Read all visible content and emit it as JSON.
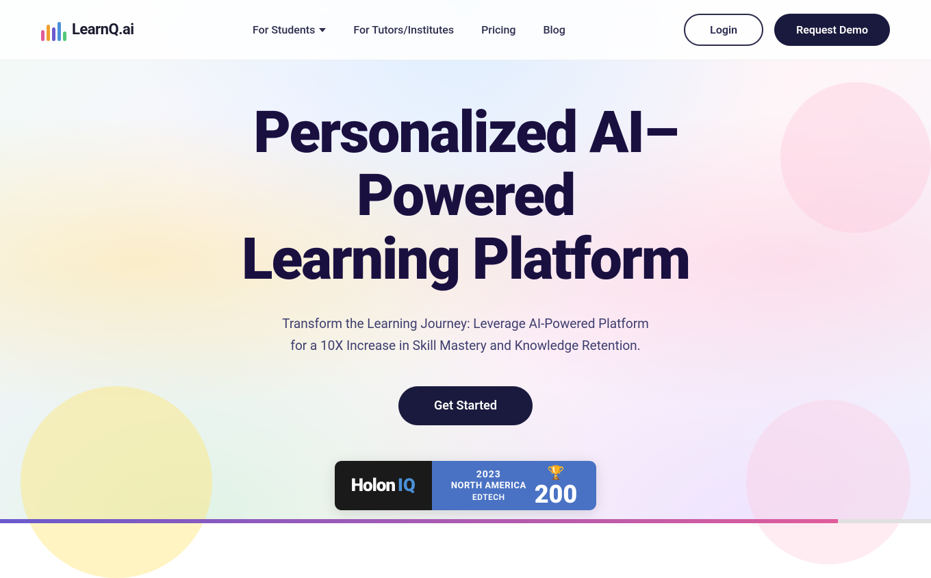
{
  "nav": {
    "logo_text": "LearnQ.ai",
    "links": [
      {
        "id": "for-students",
        "label": "For Students",
        "has_dropdown": true
      },
      {
        "id": "for-tutors",
        "label": "For Tutors/Institutes",
        "has_dropdown": false
      },
      {
        "id": "pricing",
        "label": "Pricing",
        "has_dropdown": false
      },
      {
        "id": "blog",
        "label": "Blog",
        "has_dropdown": false
      }
    ],
    "login_label": "Login",
    "demo_label": "Request Demo"
  },
  "hero": {
    "title_line1": "Personalized AI–Powered",
    "title_line2": "Learning Platform",
    "subtitle": "Transform the Learning Journey: Leverage AI-Powered Platform for a 10X Increase in Skill Mastery and Knowledge Retention.",
    "cta_label": "Get Started"
  },
  "badge": {
    "holon_text": "Holon",
    "iq_text": "IQ",
    "year": "2023",
    "region": "NORTH AMERICA",
    "category": "EDTECH",
    "trophy": "🏆",
    "number": "200"
  }
}
